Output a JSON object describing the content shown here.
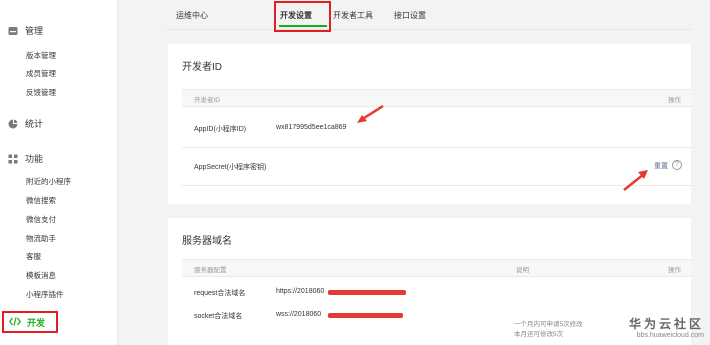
{
  "sidebar": {
    "sections": [
      {
        "label": "管理",
        "items": [
          "版本管理",
          "成员管理",
          "反馈管理"
        ]
      },
      {
        "label": "统计",
        "items": []
      },
      {
        "label": "功能",
        "items": [
          "附近的小程序",
          "微信搜索",
          "微信支付",
          "物流助手",
          "客服",
          "模板消息",
          "小程序插件"
        ]
      }
    ],
    "dev_label": "开发"
  },
  "tabs": [
    "运维中心",
    "开发设置",
    "开发者工具",
    "接口设置"
  ],
  "dev_id": {
    "title": "开发者ID",
    "col_left": "开发者ID",
    "col_right": "操作",
    "appid_label": "AppID(小程序ID)",
    "appid_value": "wx817995d5ee1ca869",
    "secret_label": "AppSecret(小程序密钥)",
    "reset_label": "重置",
    "help_glyph": "?"
  },
  "server": {
    "title": "服务器域名",
    "col_config": "服务器配置",
    "col_desc": "说明",
    "col_op": "操作",
    "rows": [
      {
        "label": "request合法域名",
        "value": "https://2018060"
      },
      {
        "label": "socket合法域名",
        "value": "wss://2018060"
      }
    ],
    "note_line1": "一个月内可申请5次修改",
    "note_line2": "本月还可修改5次"
  },
  "watermark": {
    "big": "华为云社区",
    "small": "bbs.huaweicloud.com"
  },
  "colors": {
    "accent": "#1aad19",
    "annotation": "#e02020",
    "link": "#576b95"
  }
}
